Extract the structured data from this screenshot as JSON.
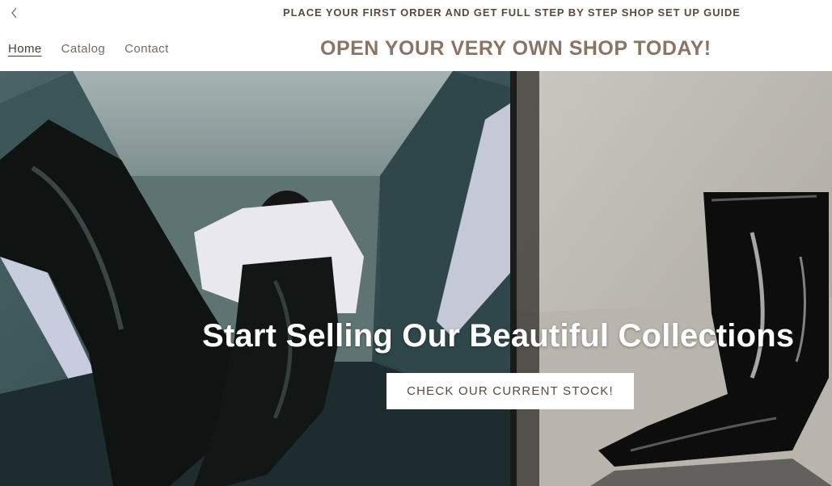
{
  "announcement": {
    "text": "PLACE YOUR FIRST ORDER AND GET FULL STEP BY STEP SHOP SET UP GUIDE",
    "prev_icon": "chevron-left-icon"
  },
  "header": {
    "nav": [
      {
        "label": "Home",
        "active": true
      },
      {
        "label": "Catalog",
        "active": false
      },
      {
        "label": "Contact",
        "active": false
      }
    ],
    "brand": "OPEN YOUR VERY OWN SHOP TODAY!"
  },
  "hero": {
    "heading": "Start Selling Our Beautiful Collections",
    "cta_label": "CHECK OUR CURRENT STOCK!",
    "left_image": "woman-in-black-leather-pants-photo",
    "right_image": "black-patent-leather-boots-photo"
  },
  "colors": {
    "text_brown": "#5a4a3d",
    "brand_tan": "#8a7464",
    "background": "#ffffff",
    "button_bg": "#ffffff"
  }
}
